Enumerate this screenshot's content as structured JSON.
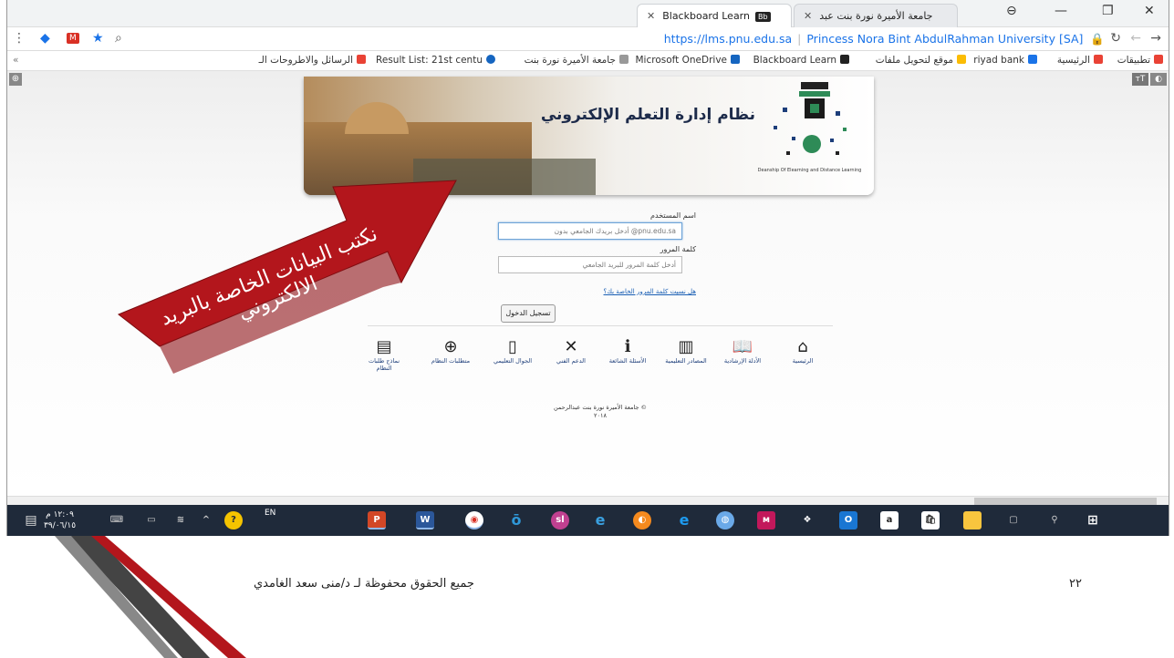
{
  "tabs": [
    {
      "title": "Blackboard Learn",
      "active": true
    },
    {
      "title": "جامعة الأميرة نورة بنت عبد",
      "active": false
    }
  ],
  "window_controls": {
    "minimize": "—",
    "restore": "❐",
    "close": "✕"
  },
  "address_bar": {
    "url": "https://lms.pnu.edu.sa",
    "org": "Princess Nora Bint AbdulRahman University [SA]"
  },
  "bookmarks": [
    {
      "label": "تطبيقات",
      "color": "#e94235"
    },
    {
      "label": "الرئيسية",
      "color": "#e94235"
    },
    {
      "label": "riyad bank",
      "color": "#1a73e8"
    },
    {
      "label": "موقع لتحويل ملفات",
      "color": "#fbbc04"
    },
    {
      "label": "Blackboard Learn",
      "color": "#222"
    },
    {
      "label": "Microsoft OneDrive",
      "color": "#1565c0"
    },
    {
      "label": "جامعة الأميرة نورة بنت",
      "color": "#777"
    },
    {
      "label": "Result List: 21st centu",
      "color": "#1565c0"
    },
    {
      "label": "الرسائل والاطروحات الـ",
      "color": "#e94235"
    }
  ],
  "page_toolbar": {
    "text_size": "тT",
    "contrast": "◐",
    "globe": "⊕"
  },
  "banner": {
    "title": "نظام إدارة التعلم الإلكتروني",
    "logo_caption": "Deanship Of Elearning and Distance Learning"
  },
  "login": {
    "username_label": "اسم المستخدم",
    "username_placeholder": "أدخل بريدك الجامعي بدون @pnu.edu.sa",
    "password_label": "كلمة المرور",
    "password_placeholder": "أدخل كلمة المرور للبريد الجامعي",
    "forgot_link": "هل نسيت كلمة المرور الخاصة بك؟",
    "submit_label": "تسجيل الدخول"
  },
  "nav_items": [
    {
      "label": "الرئيسية",
      "icon": "home-icon",
      "glyph": "⌂"
    },
    {
      "label": "الأدلة الإرشادية",
      "icon": "book-icon",
      "glyph": "📖"
    },
    {
      "label": "المصادر التعليمية",
      "icon": "library-icon",
      "glyph": "▥"
    },
    {
      "label": "الأسئلة الشائعة",
      "icon": "info-icon",
      "glyph": "ℹ"
    },
    {
      "label": "الدعم الفني",
      "icon": "tools-icon",
      "glyph": "✕"
    },
    {
      "label": "الجوال التعليمي",
      "icon": "mobile-icon",
      "glyph": "▯"
    },
    {
      "label": "متطلبات النظام",
      "icon": "globe-icon",
      "glyph": "⊕"
    },
    {
      "label": "نماذج طلبات النظام",
      "icon": "form-icon",
      "glyph": "▤"
    }
  ],
  "copyright": {
    "line1": "جامعة الأميرة نورة بنت عبدالرحمن ©",
    "line2": "٢٠١٨"
  },
  "callout": {
    "text": "نكتب البيانات الخاصة بالبريد الالكتروني",
    "color": "#b3161c"
  },
  "taskbar": {
    "time": "١٢:٠٩ م",
    "date": "٣٩/٠٦/١٥",
    "lang": "EN",
    "apps": [
      "PowerPoint",
      "Word",
      "Chrome",
      "Outlook",
      "Slack",
      "Internet Explorer",
      "Firefox",
      "Edge",
      "Network",
      "Sway",
      "Dropbox",
      "Outlook Mail",
      "Amazon",
      "Store",
      "File Explorer",
      "Task View",
      "Search",
      "Windows"
    ]
  },
  "footer": {
    "credit": "جميع الحقوق محفوظة لـ د/منى سعد الغامدي",
    "slide_number": "٢٢"
  }
}
